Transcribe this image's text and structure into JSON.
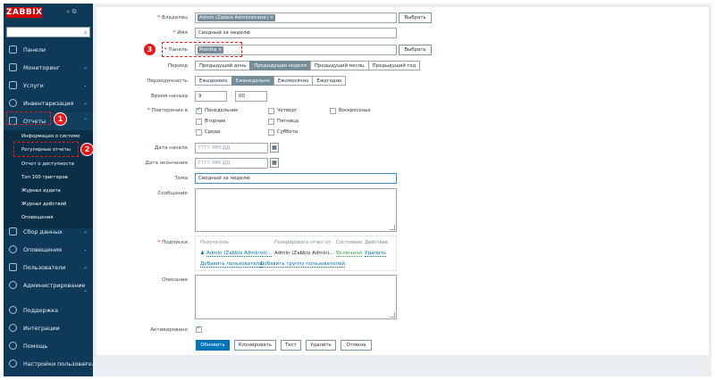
{
  "sidebar": {
    "logo": "ZABBIX",
    "top_icons": "« ⧉",
    "menu": [
      {
        "label": "Панели"
      },
      {
        "label": "Мониторинг"
      },
      {
        "label": "Услуги"
      },
      {
        "label": "Инвентаризация"
      },
      {
        "label": "Отчеты"
      },
      {
        "label": "Сбор данных"
      },
      {
        "label": "Оповещения"
      },
      {
        "label": "Пользователи"
      },
      {
        "label": "Администрирование"
      },
      {
        "label": "Поддержка"
      },
      {
        "label": "Интеграции"
      },
      {
        "label": "Помощь"
      },
      {
        "label": "Настройки пользователя"
      }
    ],
    "reports_sub": [
      "Информация о системе",
      "Регулярные отчеты",
      "Отчет о доступности",
      "Топ 100 триггеров",
      "Журнал аудита",
      "Журнал действий",
      "Оповещения"
    ],
    "chevron": "⌄"
  },
  "badges": {
    "b1": "1",
    "b2": "2",
    "b3": "3"
  },
  "form": {
    "owner_label": "Владелец",
    "owner_tag": "Admin (Zabbix Administrator) ×",
    "name_label": "Имя",
    "name_value": "Сводный за неделю",
    "dashboard_label": "Панель",
    "dashboard_tag": "Metrika ×",
    "select_label": "Выбрать",
    "period_label": "Период",
    "period_options": [
      "Предыдущий день",
      "Предыдущая неделя",
      "Предыдущий месяц",
      "Предыдущий год"
    ],
    "period_selected": "Предыдущая неделя",
    "cycle_label": "Периодичность",
    "cycle_options": [
      "Ежедневно",
      "Еженедельно",
      "Ежемесячно",
      "Ежегодно"
    ],
    "cycle_selected": "Еженедельно",
    "start_time_label": "Время начала",
    "start_hour": "9",
    "start_sep": ":",
    "start_min": "00",
    "repeat_label": "Повторение в",
    "days": [
      {
        "label": "Понедельник",
        "checked": true
      },
      {
        "label": "Четверг",
        "checked": false
      },
      {
        "label": "Воскресенье",
        "checked": false
      },
      {
        "label": "Вторник",
        "checked": false
      },
      {
        "label": "Пятница",
        "checked": false
      },
      {
        "label": "Среда",
        "checked": false
      },
      {
        "label": "Суббота",
        "checked": false
      }
    ],
    "start_date_label": "Дата начала",
    "end_date_label": "Дата окончания",
    "date_placeholder": "ГГГГ-ММ-ДД",
    "subject_label": "Тема",
    "subject_value": "Сводный за неделю",
    "message_label": "Сообщение",
    "subscriptions_label": "Подписки",
    "sub_headers": [
      "Получатель",
      "Генерировать отчет от",
      "Состояние",
      "Действие"
    ],
    "sub_row": {
      "recipient": "Admin (Zabbix Administr...",
      "generate_by": "Admin (Zabbix Admini...",
      "status": "Включено",
      "action": "Удалить"
    },
    "add_user": "Добавить пользователя",
    "add_group": "Добавить группу пользователей",
    "description_label": "Описание",
    "enabled_label": "Активировано",
    "buttons": {
      "update": "Обновить",
      "clone": "Клонировать",
      "test": "Тест",
      "delete": "Удалить",
      "cancel": "Отмена"
    }
  }
}
